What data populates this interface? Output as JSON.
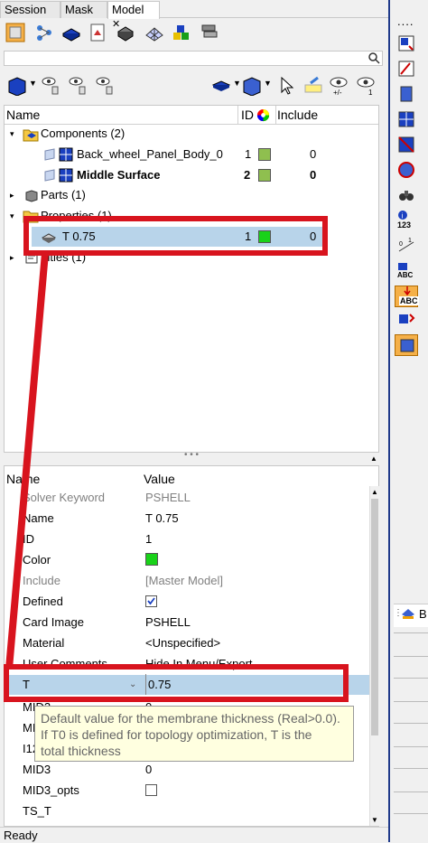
{
  "tabs": [
    {
      "label": "Session"
    },
    {
      "label": "Mask"
    },
    {
      "label": "Model"
    }
  ],
  "tab_close": "✕",
  "tree_header": {
    "name": "Name",
    "id": "ID",
    "include": "Include"
  },
  "tree": {
    "components": {
      "label": "Components (2)"
    },
    "comp1": {
      "label": "Back_wheel_Panel_Body_0",
      "id": "1",
      "include": "0"
    },
    "comp2": {
      "label": "Middle Surface",
      "id": "2",
      "include": "0"
    },
    "parts": {
      "label": "Parts (1)"
    },
    "properties": {
      "label": "Properties (1)"
    },
    "prop1": {
      "label": "T 0.75",
      "id": "1",
      "include": "0"
    },
    "titles": {
      "label": "Titles (1)"
    }
  },
  "splitter_grip": "• • •",
  "props_header": {
    "name": "Name",
    "value": "Value"
  },
  "props": {
    "solver_keyword": {
      "label": "Solver Keyword",
      "value": "PSHELL"
    },
    "name": {
      "label": "Name",
      "value": "T 0.75"
    },
    "id": {
      "label": "ID",
      "value": "1"
    },
    "color": {
      "label": "Color"
    },
    "include": {
      "label": "Include",
      "value": "[Master Model]"
    },
    "defined": {
      "label": "Defined"
    },
    "card_image": {
      "label": "Card Image",
      "value": "PSHELL"
    },
    "material": {
      "label": "Material",
      "value": "<Unspecified>"
    },
    "user_comments": {
      "label": "User Comments",
      "value": "Hide In Menu/Export"
    },
    "t": {
      "label": "T",
      "value": "0.75"
    },
    "mid2": {
      "label": "MID2",
      "value": "0"
    },
    "mid2_opts": {
      "label": "MID2_opts"
    },
    "i12_t3": {
      "label": "I12_T3"
    },
    "mid3": {
      "label": "MID3",
      "value": "0"
    },
    "mid3_opts": {
      "label": "MID3_opts"
    },
    "ts_t": {
      "label": "TS_T"
    }
  },
  "tooltip": {
    "line1": "Default value for the membrane thickness (Real>0.0).",
    "line2": "If T0 is defined for topology optimization, T is the",
    "line3": "total thickness"
  },
  "status": "Ready",
  "right_bar": {
    "dots": "....",
    "count_label": "123",
    "abc": "ABC",
    "partial_label": "B"
  },
  "colors": {
    "accent_red": "#d8141e",
    "selection": "#b8d4ea",
    "comp_green": "#8fbf4f",
    "prop_green": "#19d219"
  }
}
